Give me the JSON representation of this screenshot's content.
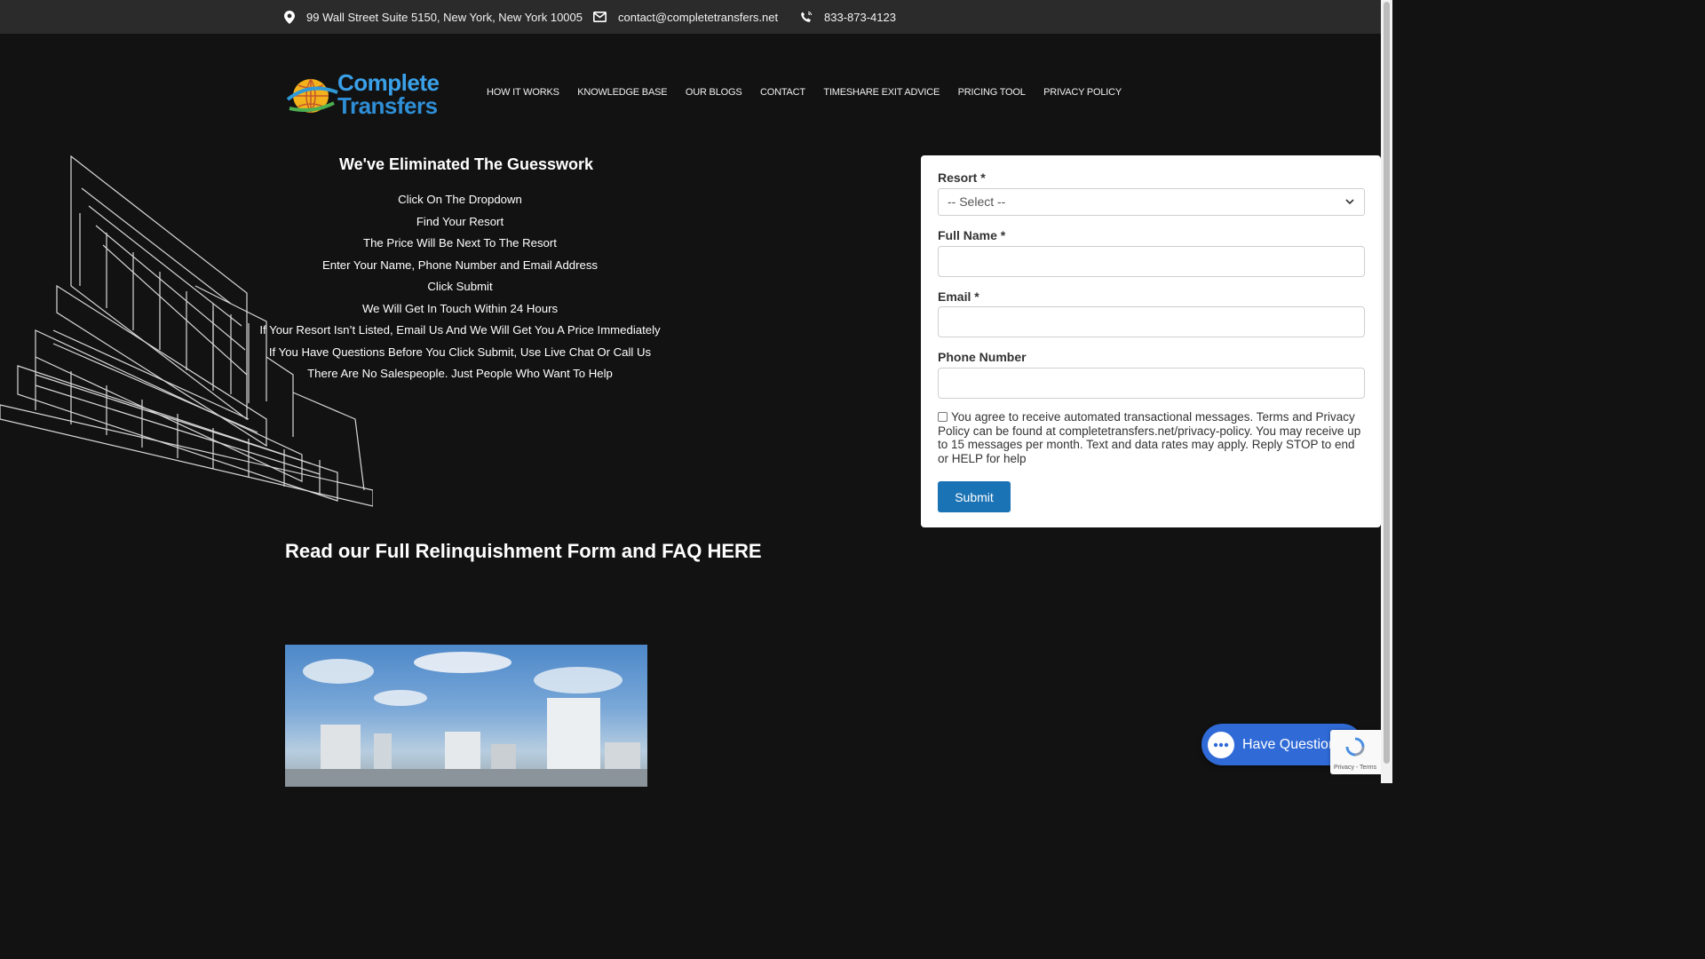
{
  "topbar": {
    "address": "99 Wall Street Suite 5150, New York, New York 10005",
    "email": "contact@completetransfers.net",
    "phone": "833-873-4123"
  },
  "logo": {
    "line1": "Complete",
    "line2": "Transfers"
  },
  "nav": [
    "HOW IT WORKS",
    "KNOWLEDGE BASE",
    "OUR BLOGS",
    "CONTACT",
    "TIMESHARE EXIT ADVICE",
    "PRICING TOOL",
    "PRIVACY POLICY"
  ],
  "steps": {
    "title": "We've Eliminated The Guesswork",
    "items": [
      "Click On The Dropdown",
      "Find Your Resort",
      "The Price Will Be Next To The Resort",
      "Enter Your Name, Phone Number and Email Address",
      "Click Submit",
      "We Will Get In Touch Within 24 Hours",
      "If Your Resort Isn’t Listed, Email Us And We Will Get You A Price Immediately",
      "If You Have Questions Before You Click Submit, Use Live Chat Or Call Us",
      "There Are No Salespeople. Just People Who Want To Help"
    ]
  },
  "faq_link": "Read our Full Relinquishment Form and FAQ HERE",
  "form": {
    "resort_label": "Resort *",
    "resort_value": "-- Select --",
    "name_label": "Full Name *",
    "email_label": "Email *",
    "phone_label": "Phone Number",
    "consent": "You agree to receive automated transactional messages. Terms and Privacy Policy can be found at completetransfers.net/privacy-policy. You may receive up to 15 messages per month. Text and data rates may apply. Reply STOP to end or HELP for help",
    "submit": "Submit"
  },
  "chat": {
    "label": "Have Questions?"
  },
  "recaptcha": {
    "text": "Privacy - Terms"
  },
  "colors": {
    "accent": "#1a73b5",
    "chat": "#2f6ad6",
    "topbar": "#2b2b2b",
    "background": "#121212"
  }
}
